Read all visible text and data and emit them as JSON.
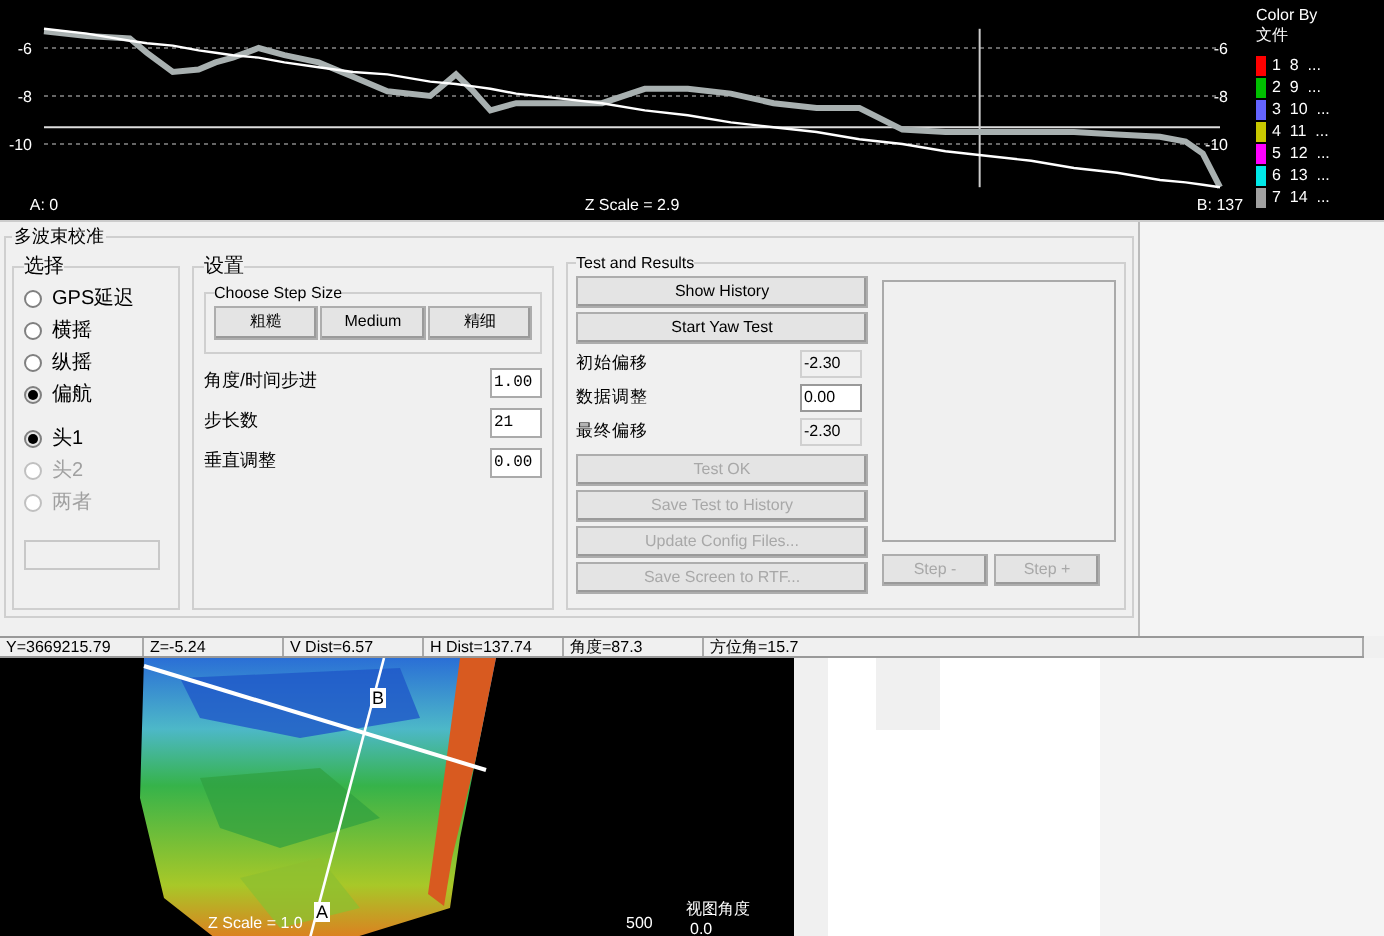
{
  "profile_chart": {
    "chart_data": {
      "type": "line",
      "xlim": [
        0,
        137
      ],
      "ylim": [
        -11.8,
        -5.2
      ],
      "grid": true,
      "yticks": [
        -6,
        -8,
        -10
      ],
      "xticks": [
        {
          "value": 0,
          "label": "A: 0"
        },
        {
          "value": 137,
          "label": "B: 137"
        }
      ],
      "x": [
        0,
        5,
        10,
        12,
        15,
        18,
        20,
        22,
        25,
        28,
        32,
        36,
        40,
        45,
        48,
        50,
        52,
        55,
        60,
        65,
        70,
        75,
        80,
        85,
        90,
        95,
        100,
        105,
        110,
        115,
        120,
        125,
        130,
        133,
        135,
        137
      ],
      "series": [
        {
          "color": "#a8b0b0",
          "values": [
            -5.3,
            -5.5,
            -5.6,
            -6.2,
            -7.0,
            -6.9,
            -6.6,
            -6.4,
            -6.0,
            -6.3,
            -6.6,
            -7.2,
            -7.8,
            -8.0,
            -7.1,
            -7.8,
            -8.6,
            -8.3,
            -8.3,
            -8.3,
            -7.7,
            -7.7,
            -7.9,
            -8.3,
            -8.5,
            -8.5,
            -9.4,
            -9.5,
            -9.5,
            -9.5,
            -9.5,
            -9.6,
            -9.7,
            -9.9,
            -10.4,
            -11.8
          ]
        },
        {
          "color": "#ffffff",
          "values": [
            -5.2,
            -5.4,
            -5.7,
            -5.8,
            -5.9,
            -6.1,
            -6.2,
            -6.3,
            -6.4,
            -6.6,
            -6.8,
            -7.0,
            -7.1,
            -7.4,
            -7.5,
            -7.6,
            -7.7,
            -7.9,
            -8.1,
            -8.3,
            -8.6,
            -8.8,
            -9.1,
            -9.3,
            -9.5,
            -9.8,
            -10.0,
            -10.3,
            -10.5,
            -10.7,
            -11.0,
            -11.2,
            -11.5,
            -11.6,
            -11.7,
            -11.8
          ]
        }
      ],
      "ref_lines": [
        {
          "axis": "y",
          "value": -9.3
        },
        {
          "axis": "x",
          "value": 109
        }
      ]
    },
    "left_axis_labels": [
      "-6",
      "-8",
      "-10"
    ],
    "center_label": "Z Scale = 2.9",
    "legend": {
      "title": "Color By",
      "subtitle": "文件",
      "items": [
        {
          "label": "1  8  ...",
          "color": "#ff0000"
        },
        {
          "label": "2  9  ...",
          "color": "#00c000"
        },
        {
          "label": "3  10  ...",
          "color": "#6464ff"
        },
        {
          "label": "4  11  ...",
          "color": "#c8c800"
        },
        {
          "label": "5  12  ...",
          "color": "#ff00ff"
        },
        {
          "label": "6  13  ...",
          "color": "#00e8e8"
        },
        {
          "label": "7  14  ...",
          "color": "#a0a0a0"
        }
      ]
    }
  },
  "dialog": {
    "title": "多波束校准",
    "select_group": {
      "title": "选择",
      "options": [
        {
          "label": "GPS延迟",
          "selected": false
        },
        {
          "label": "横摇",
          "selected": false
        },
        {
          "label": "纵摇",
          "selected": false
        },
        {
          "label": "偏航",
          "selected": true
        }
      ],
      "heads": [
        {
          "label": "头1",
          "selected": true,
          "disabled": false
        },
        {
          "label": "头2",
          "selected": false,
          "disabled": true
        },
        {
          "label": "两者",
          "selected": false,
          "disabled": true
        }
      ]
    },
    "settings_group": {
      "title": "设置",
      "step_size": {
        "title": "Choose Step Size",
        "buttons": [
          "粗糙",
          "Medium",
          "精细"
        ]
      },
      "fields": [
        {
          "label": "角度/时间步进",
          "value": "1.00"
        },
        {
          "label": "步长数",
          "value": "21"
        },
        {
          "label": "垂直调整",
          "value": "0.00"
        }
      ]
    },
    "test_group": {
      "title": "Test and Results",
      "top_buttons": [
        {
          "label": "Show History",
          "disabled": false
        },
        {
          "label": "Start Yaw Test",
          "disabled": false
        }
      ],
      "fields": [
        {
          "label": "初始偏移",
          "value": "-2.30",
          "readonly": true
        },
        {
          "label": "数据调整",
          "value": "0.00",
          "readonly": false
        },
        {
          "label": "最终偏移",
          "value": "-2.30",
          "readonly": true
        }
      ],
      "bottom_buttons": [
        {
          "label": "Test OK",
          "disabled": true
        },
        {
          "label": "Save Test to History",
          "disabled": true
        },
        {
          "label": "Update Config Files...",
          "disabled": true
        },
        {
          "label": "Save Screen to RTF...",
          "disabled": true
        }
      ],
      "step_buttons": [
        {
          "label": "Step -",
          "disabled": true
        },
        {
          "label": "Step +",
          "disabled": true
        }
      ]
    }
  },
  "status_bar": [
    "Y=3669215.79",
    "Z=-5.24",
    "V Dist=6.57",
    "H Dist=137.74",
    "角度=87.3",
    "方位角=15.7"
  ],
  "map_view": {
    "kind": "picture",
    "marker_b": "B",
    "marker_a": "A",
    "z_scale": "Z Scale = 1.0",
    "scale_label": "500",
    "view_angle_label": "视图角度",
    "view_angle_value": "0.0"
  }
}
